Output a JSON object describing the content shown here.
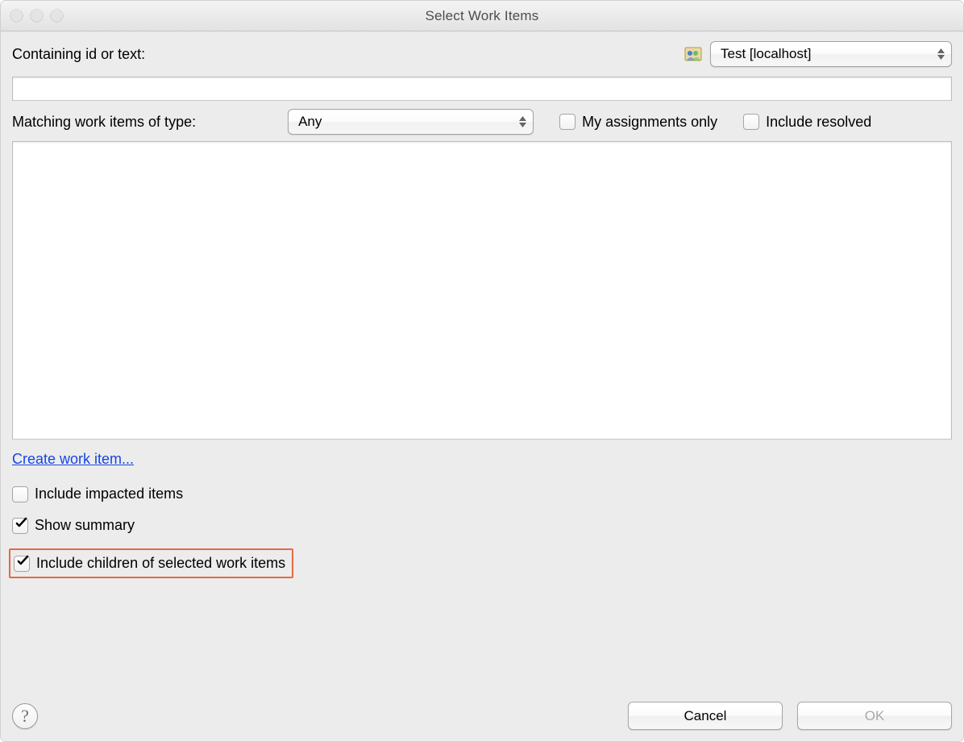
{
  "title": "Select Work Items",
  "top": {
    "containing_label": "Containing id or text:",
    "project_selected": "Test [localhost]"
  },
  "search_value": "",
  "filter": {
    "matching_label": "Matching work items of type:",
    "type_selected": "Any",
    "my_assignments_label": "My assignments only",
    "my_assignments_checked": false,
    "include_resolved_label": "Include resolved",
    "include_resolved_checked": false
  },
  "create_link": "Create work item...",
  "options": {
    "impacted_label": "Include impacted items",
    "impacted_checked": false,
    "summary_label": "Show summary",
    "summary_checked": true,
    "children_label": "Include children of selected work items",
    "children_checked": true
  },
  "buttons": {
    "cancel": "Cancel",
    "ok": "OK"
  },
  "help_glyph": "?"
}
